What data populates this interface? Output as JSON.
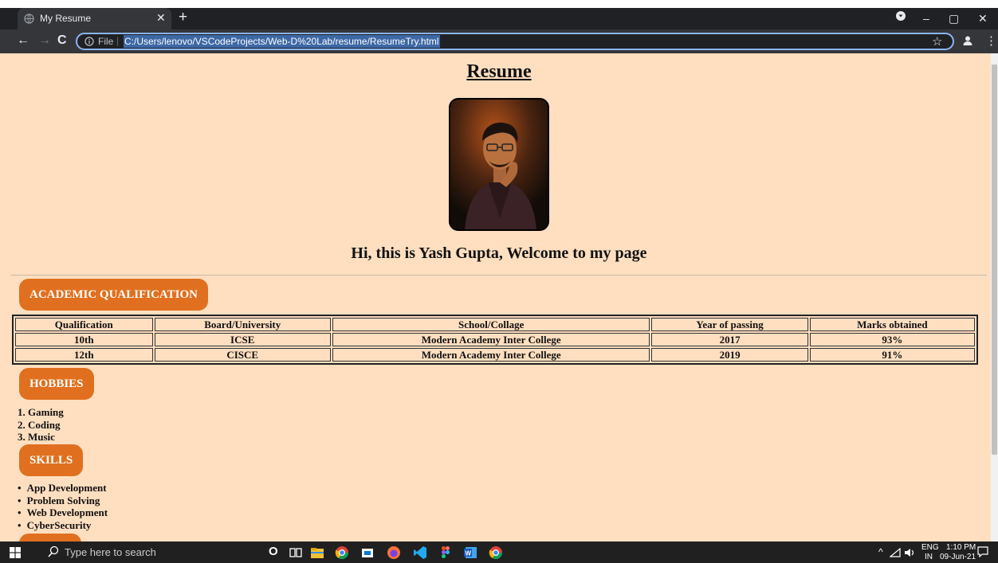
{
  "browser": {
    "tab_title": "My Resume",
    "file_label": "File",
    "url": "C:/Users/lenovo/VSCodeProjects/Web-D%20Lab/resume/ResumeTry.html"
  },
  "page": {
    "heading": "Resume",
    "welcome": "Hi, this is Yash Gupta, Welcome to my page",
    "academic_label": "ACADEMIC QUALIFICATION",
    "table": {
      "headers": [
        "Qualification",
        "Board/University",
        "School/Collage",
        "Year of passing",
        "Marks obtained"
      ],
      "rows": [
        [
          "10th",
          "ICSE",
          "Modern Academy Inter College",
          "2017",
          "93%"
        ],
        [
          "12th",
          "CISCE",
          "Modern Academy Inter College",
          "2019",
          "91%"
        ]
      ]
    },
    "hobbies_label": "HOBBIES",
    "hobbies": [
      "1. Gaming",
      "2. Coding",
      "3. Music"
    ],
    "skills_label": "SKILLS",
    "skills": [
      "App Development",
      "Problem Solving",
      "Web Development",
      "CyberSecurity"
    ]
  },
  "taskbar": {
    "search_placeholder": "Type here to search",
    "lang": "ENG",
    "region": "IN",
    "time": "1:10 PM",
    "date": "09-Jun-21"
  },
  "colors": {
    "page_background": "#ffdfc0",
    "section_pill": "#e0701f",
    "browser_frame": "#202124",
    "toolbar": "#35363a"
  }
}
